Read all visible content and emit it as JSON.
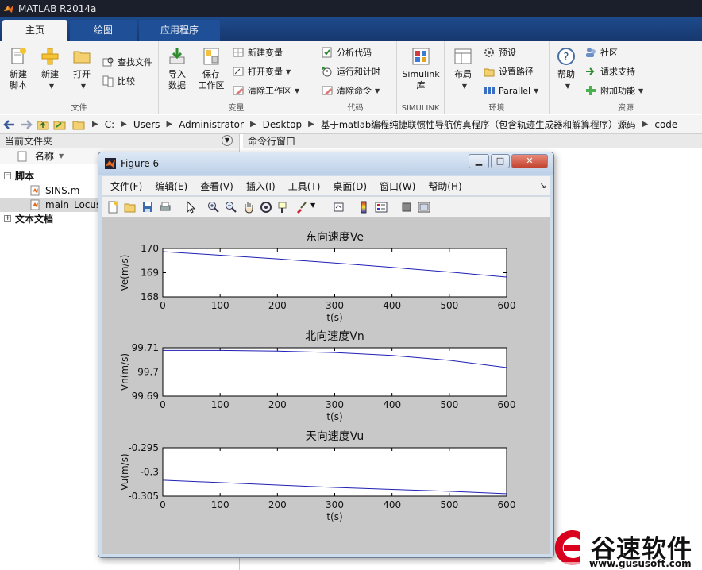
{
  "app": {
    "title": "MATLAB R2014a"
  },
  "tabs": [
    {
      "label": "主页",
      "active": true
    },
    {
      "label": "绘图",
      "active": false
    },
    {
      "label": "应用程序",
      "active": false
    }
  ],
  "ribbon": {
    "groups": {
      "file": "文件",
      "variable": "变量",
      "code": "代码",
      "simulink": "SIMULINK",
      "environment": "环境",
      "resources": "资源"
    },
    "new_script": [
      "新建",
      "脚本"
    ],
    "new": "新建",
    "open": "打开",
    "find_files": "查找文件",
    "compare": "比较",
    "import": [
      "导入",
      "数据"
    ],
    "save_ws": [
      "保存",
      "工作区"
    ],
    "new_var": "新建变量",
    "open_var": "打开变量",
    "clear_ws": "清除工作区",
    "analyze_code": "分析代码",
    "run_time": "运行和计时",
    "clear_cmd": "清除命令",
    "simulink": [
      "Simulink",
      "库"
    ],
    "layout": "布局",
    "prefs": "预设",
    "set_path": "设置路径",
    "parallel": "Parallel",
    "help": "帮助",
    "community": "社区",
    "support": "请求支持",
    "addons": "附加功能"
  },
  "address": {
    "crumbs": [
      "C:",
      "Users",
      "Administrator",
      "Desktop",
      "基于matlab编程纯捷联惯性导航仿真程序（包含轨迹生成器和解算程序）源码",
      "code"
    ]
  },
  "left_panel": {
    "title": "当前文件夹",
    "col_name": "名称",
    "folder_scripts": "脚本",
    "file1": "SINS.m",
    "file2": "main_Locus",
    "folder_docs": "文本文档"
  },
  "command_window": {
    "title": "命令行窗口"
  },
  "figure": {
    "title": "Figure 6",
    "menus": [
      "文件(F)",
      "编辑(E)",
      "查看(V)",
      "插入(I)",
      "工具(T)",
      "桌面(D)",
      "窗口(W)",
      "帮助(H)"
    ]
  },
  "chart_data": [
    {
      "type": "line",
      "title": "东向速度Ve",
      "xlabel": "t(s)",
      "ylabel": "Ve(m/s)",
      "xlim": [
        0,
        600
      ],
      "ylim": [
        168,
        170
      ],
      "xticks": [
        0,
        100,
        200,
        300,
        400,
        500,
        600
      ],
      "yticks": [
        168,
        169,
        170
      ],
      "ytick_labels": [
        "168",
        "169",
        "170"
      ],
      "grid": false,
      "color": "#1f1fb4",
      "x": [
        0,
        100,
        200,
        300,
        400,
        500,
        600
      ],
      "y": [
        169.87,
        169.72,
        169.57,
        169.4,
        169.22,
        169.03,
        168.82
      ]
    },
    {
      "type": "line",
      "title": "北向速度Vn",
      "xlabel": "t(s)",
      "ylabel": "Vn(m/s)",
      "xlim": [
        0,
        600
      ],
      "ylim": [
        99.69,
        99.71
      ],
      "xticks": [
        0,
        100,
        200,
        300,
        400,
        500,
        600
      ],
      "yticks": [
        99.69,
        99.7,
        99.71
      ],
      "ytick_labels": [
        "99.69",
        "99.7",
        "99.71"
      ],
      "grid": false,
      "color": "#1f1fb4",
      "x": [
        0,
        100,
        200,
        300,
        400,
        500,
        600
      ],
      "y": [
        99.7089,
        99.7089,
        99.7086,
        99.708,
        99.7068,
        99.7048,
        99.7018
      ]
    },
    {
      "type": "line",
      "title": "天向速度Vu",
      "xlabel": "t(s)",
      "ylabel": "Vu(m/s)",
      "xlim": [
        0,
        600
      ],
      "ylim": [
        -0.305,
        -0.295
      ],
      "xticks": [
        0,
        100,
        200,
        300,
        400,
        500,
        600
      ],
      "yticks": [
        -0.305,
        -0.3,
        -0.295
      ],
      "ytick_labels": [
        "-0.305",
        "-0.3",
        "-0.295"
      ],
      "grid": false,
      "color": "#1f1fb4",
      "x": [
        0,
        100,
        200,
        300,
        400,
        500,
        600
      ],
      "y": [
        -0.3017,
        -0.3022,
        -0.3027,
        -0.3032,
        -0.3036,
        -0.304,
        -0.3045
      ]
    }
  ],
  "watermark": {
    "brand": "谷速软件",
    "url": "www.gususoft.com",
    "accent": "#d8001c"
  }
}
